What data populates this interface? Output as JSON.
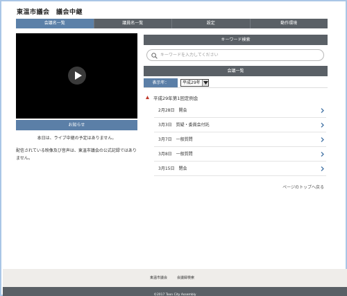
{
  "site": {
    "title": "東温市議会　議会中継"
  },
  "nav": {
    "tabs": [
      {
        "label": "会議名一覧",
        "active": true
      },
      {
        "label": "議員名一覧",
        "active": false
      },
      {
        "label": "設定",
        "active": false
      },
      {
        "label": "動作環境",
        "active": false
      }
    ]
  },
  "player": {
    "play_icon": "play-icon"
  },
  "notice": {
    "header": "お知らせ",
    "text": "本日は、ライブ中継の予定はありません。",
    "disclaimer": "配信されている映像及び音声は、東温市議会の公式記録ではありません。"
  },
  "keyword": {
    "header": "キーワード検索",
    "placeholder": "キーワードを入力してください",
    "icon": "search-icon"
  },
  "meeting_list": {
    "header": "会議一覧",
    "year_label": "表示年：",
    "year_value": "平成29年",
    "session_title": "平成29年第1回定例会",
    "items": [
      {
        "label": "2月28日　開会"
      },
      {
        "label": "3月3日　質疑・委員会付託"
      },
      {
        "label": "3月7日　一般質問"
      },
      {
        "label": "3月8日　一般質問"
      },
      {
        "label": "3月15日　閉会"
      }
    ]
  },
  "page_top": "ページのトップへ戻る",
  "footer": {
    "links": [
      "東温市議会",
      "会議録検索"
    ],
    "copyright": "©2017 Toon City Assembly"
  },
  "colors": {
    "nav_bg": "#5a6066",
    "accent_blue": "#5b7fa7",
    "chevron": "#4a78a8",
    "session_marker": "#c0392b"
  }
}
